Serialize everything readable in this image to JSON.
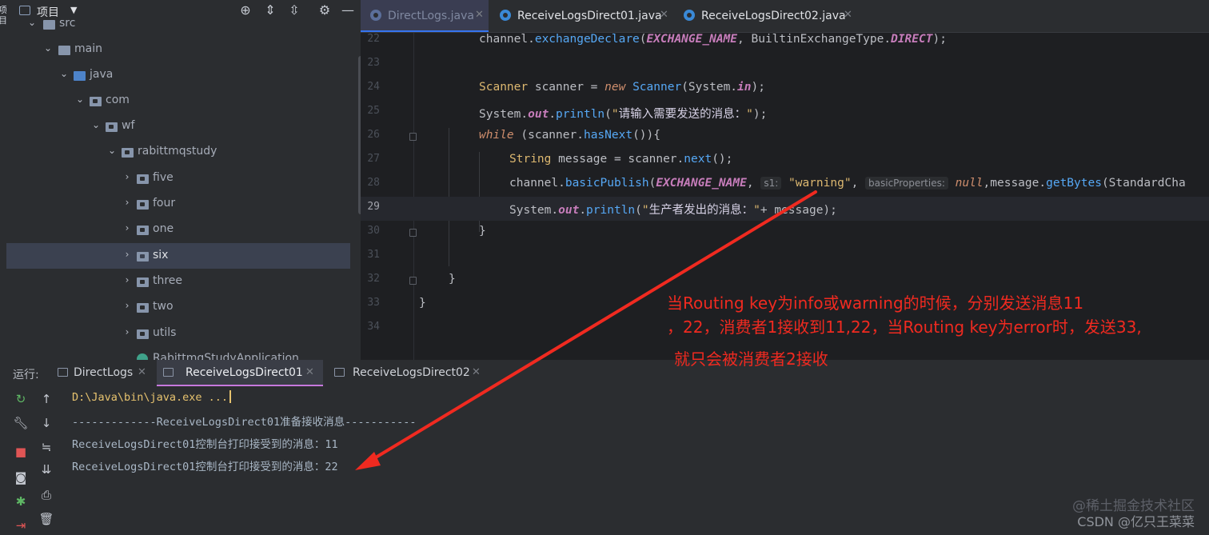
{
  "left_strip": {
    "text": "项目"
  },
  "project_panel": {
    "title": "项目",
    "tree": [
      {
        "label": "src",
        "kind": "folder"
      },
      {
        "label": "main",
        "kind": "folder"
      },
      {
        "label": "java",
        "kind": "folder-blue"
      },
      {
        "label": "com",
        "kind": "package"
      },
      {
        "label": "wf",
        "kind": "package"
      },
      {
        "label": "rabittmqstudy",
        "kind": "package"
      },
      {
        "label": "five",
        "kind": "package"
      },
      {
        "label": "four",
        "kind": "package"
      },
      {
        "label": "one",
        "kind": "package"
      },
      {
        "label": "six",
        "kind": "package",
        "selected": true
      },
      {
        "label": "three",
        "kind": "package"
      },
      {
        "label": "two",
        "kind": "package"
      },
      {
        "label": "utils",
        "kind": "package"
      },
      {
        "label": "RabittmqStudyApplication",
        "kind": "class"
      }
    ]
  },
  "editor": {
    "tabs": [
      {
        "label": "DirectLogs.java",
        "active": true
      },
      {
        "label": "ReceiveLogsDirect01.java",
        "active": false
      },
      {
        "label": "ReceiveLogsDirect02.java",
        "active": false
      }
    ],
    "line_numbers": [
      "22",
      "23",
      "24",
      "25",
      "26",
      "27",
      "28",
      "29",
      "30",
      "31",
      "32",
      "33",
      "34"
    ],
    "current_line": "29",
    "hints": {
      "s1": "s1:",
      "basic_properties": "basicProperties:"
    }
  },
  "annotation": {
    "line1": "当Routing key为info或warning的时候，分别发送消息11",
    "line2": "，22，消费者1接收到11,22，当Routing key为error时，发送33,",
    "line3": "就只会被消费者2接收",
    "color": "#f02a20"
  },
  "run_panel": {
    "label": "运行:",
    "tabs": [
      {
        "label": "DirectLogs",
        "active": false
      },
      {
        "label": "ReceiveLogsDirect01",
        "active": true
      },
      {
        "label": "ReceiveLogsDirect02",
        "active": false
      }
    ],
    "console_lines": [
      "D:\\Java\\bin\\java.exe ...",
      "-------------ReceiveLogsDirect01准备接收消息-----------",
      "ReceiveLogsDirect01控制台打印接受到的消息：11",
      "ReceiveLogsDirect01控制台打印接受到的消息：22"
    ]
  },
  "watermark": {
    "line1": "@稀土掘金技术社区",
    "line2": "CSDN @亿只王菜菜"
  },
  "icons": {
    "project_toolbar": [
      "target-icon",
      "expand-all-icon",
      "collapse-all-icon",
      "gear-icon",
      "minimize-icon"
    ],
    "run_left": [
      "rerun-icon",
      "wrench-icon",
      "stop-icon",
      "camera-icon",
      "debug-bug-icon",
      "exit-icon"
    ],
    "run_right": [
      "up-arrow-icon",
      "down-arrow-icon",
      "soft-wrap-icon",
      "scroll-to-end-icon",
      "print-icon",
      "trash-icon"
    ]
  }
}
